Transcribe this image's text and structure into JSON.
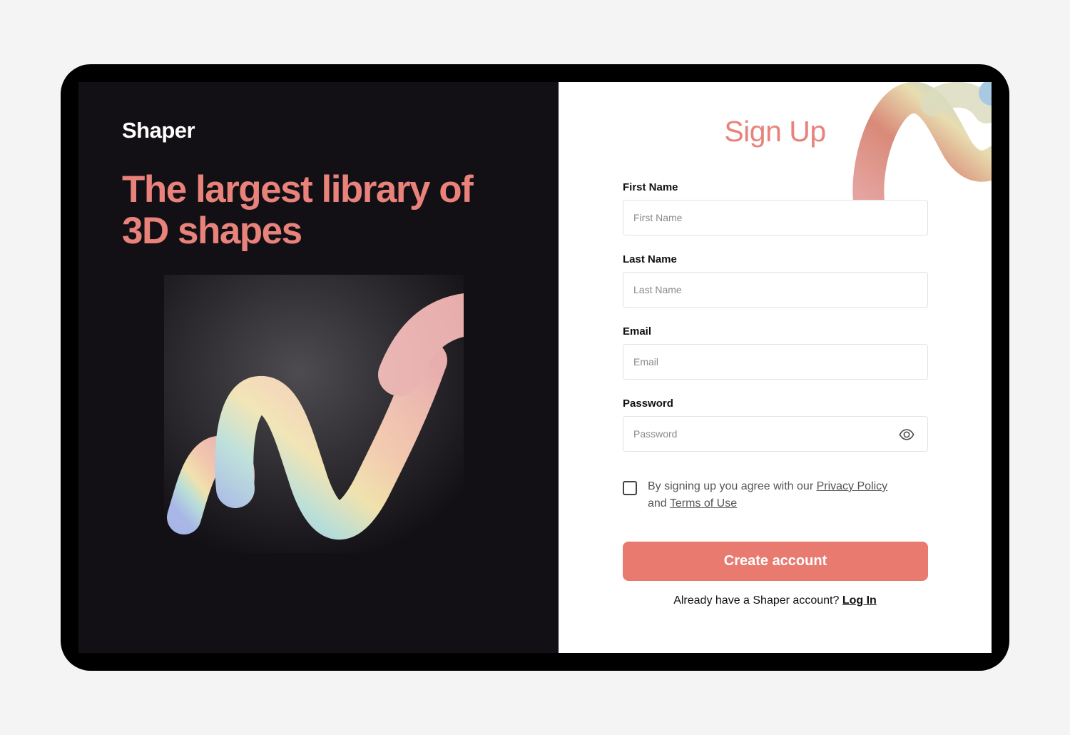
{
  "brand": {
    "name": "Shaper"
  },
  "hero": {
    "headline_line1": "The largest library of",
    "headline_line2": "3D shapes"
  },
  "form": {
    "title": "Sign Up",
    "first_name": {
      "label": "First Name",
      "placeholder": "First Name",
      "value": ""
    },
    "last_name": {
      "label": "Last Name",
      "placeholder": "Last Name",
      "value": ""
    },
    "email": {
      "label": "Email",
      "placeholder": "Email",
      "value": ""
    },
    "password": {
      "label": "Password",
      "placeholder": "Password",
      "value": "",
      "toggle_icon": "eye-icon"
    },
    "agreement": {
      "checked": false,
      "text_before": "By signing up you agree with our ",
      "privacy_link": "Privacy Policy ",
      "text_middle": "and ",
      "terms_link": "Terms of Use"
    },
    "submit_label": "Create account",
    "login_prompt": "Already have a Shaper account? ",
    "login_link": "Log In"
  },
  "colors": {
    "accent": "#e8827a",
    "button": "#e87a70",
    "left_panel_bg": "#121015",
    "page_bg": "#f4f4f4"
  }
}
